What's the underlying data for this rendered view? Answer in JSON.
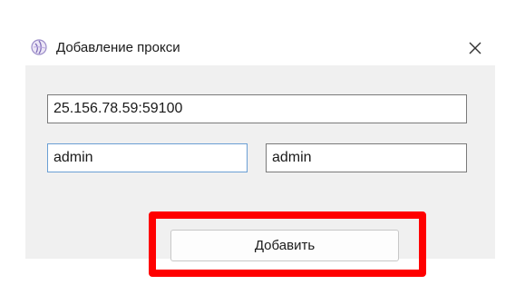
{
  "window": {
    "title": "Добавление прокси",
    "app_icon": "app-logo-icon",
    "close_icon": "close-icon"
  },
  "form": {
    "proxy_value": "25.156.78.59:59100",
    "login_value": "admin",
    "password_value": "admin",
    "add_button_label": "Добавить"
  },
  "colors": {
    "highlight": "#ff0000",
    "focus_border": "#6a9fd4"
  }
}
